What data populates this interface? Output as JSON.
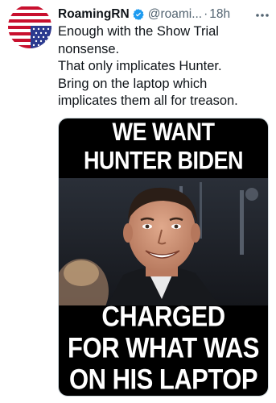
{
  "tweet": {
    "author_name": "RoamingRN",
    "handle": "@roami...",
    "separator": "·",
    "time": "18h",
    "text_lines": [
      "Enough with the Show Trial",
      "nonsense.",
      "That only implicates Hunter.",
      "Bring on the laptop which",
      "implicates them all for treason."
    ],
    "avatar_icon": "upside-down-us-flag-icon",
    "verified_icon": "verified-badge-icon",
    "more_icon": "more-options-icon",
    "colors": {
      "verified": "#1d9bf0",
      "secondary_text": "#536471",
      "primary_text": "#0f1419"
    }
  },
  "media": {
    "top_lines": [
      "WE WANT",
      "HUNTER BIDEN"
    ],
    "bottom_lines": [
      "CHARGED",
      "FOR WHAT WAS",
      "ON HIS LAPTOP"
    ]
  }
}
